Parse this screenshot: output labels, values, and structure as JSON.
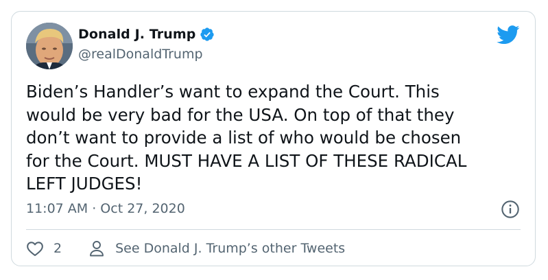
{
  "colors": {
    "text_primary": "#0f1419",
    "text_secondary": "#536471",
    "border": "#cfd9de",
    "twitter_blue": "#1d9bf0"
  },
  "user": {
    "display_name": "Donald J. Trump",
    "handle": "@realDonaldTrump",
    "verified_icon": "verified-badge-icon",
    "avatar_icon": "avatar"
  },
  "brand": {
    "icon": "twitter-bird-icon"
  },
  "tweet": {
    "text": "Biden’s Handler’s want to expand the Court. This\nwould be very bad for the USA. On top of that they\ndon’t want to provide a list of who would be chosen\nfor the Court. MUST HAVE A LIST OF THESE RADICAL\nLEFT JUDGES!",
    "timestamp": "11:07 AM · Oct 27, 2020",
    "info_icon": "info-icon"
  },
  "actions": {
    "like_icon": "heart-icon",
    "like_count": "2",
    "profile_icon": "person-icon",
    "profile_link_label": "See Donald J. Trump’s other Tweets"
  }
}
